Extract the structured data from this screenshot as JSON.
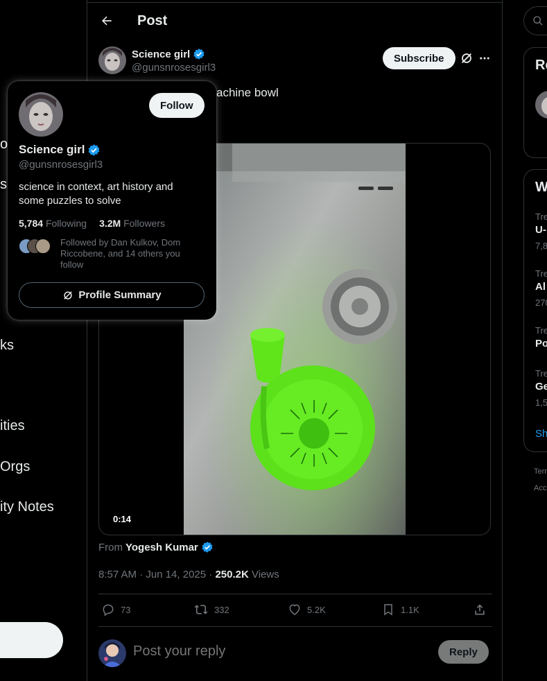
{
  "nav": {
    "fragments": [
      "o",
      "s",
      "ks",
      "ities",
      "Orgs",
      "ity Notes"
    ]
  },
  "header": {
    "title": "Post"
  },
  "post": {
    "author_name": "Science girl",
    "author_handle": "@gunsnrosesgirl3",
    "subscribe_label": "Subscribe",
    "text_visible": "achine bowl",
    "video_time": "0:14",
    "from_label": "From",
    "from_name": "Yogesh Kumar",
    "timestamp": "8:57 AM · Jun 14, 2025 · ",
    "views_count": "250.2K",
    "views_label": " Views",
    "replies": "73",
    "reposts": "332",
    "likes": "5.2K",
    "bookmarks": "1.1K"
  },
  "reply": {
    "placeholder": "Post your reply",
    "button_label": "Reply"
  },
  "hovercard": {
    "follow_label": "Follow",
    "name": "Science girl",
    "handle": "@gunsnrosesgirl3",
    "bio": "science in context, art history and some puzzles to solve",
    "following_count": "5,784",
    "following_label": "Following",
    "followers_count": "3.2M",
    "followers_label": "Followers",
    "followed_by": "Followed by Dan Kulkov, Dom Riccobene, and 14 others you follow",
    "profile_summary_label": "Profile Summary"
  },
  "right": {
    "panel1_heading": "Re",
    "panel2_heading": "W",
    "trends": [
      {
        "small": "Tre",
        "bold": "U-",
        "count": "7,8"
      },
      {
        "small": "Tre",
        "bold": "Al",
        "count": "270"
      },
      {
        "small": "Tre",
        "bold": "Po",
        "count": ""
      },
      {
        "small": "Tre",
        "bold": "Ge",
        "count": "1,5"
      }
    ],
    "show_more": "Sh",
    "footer": [
      "Terr",
      "Acc"
    ]
  },
  "colors": {
    "background": "#000000",
    "border": "#2f3336",
    "muted": "#71767b",
    "verified": "#1d9bf0",
    "bowl_green": "#5ee81c"
  }
}
